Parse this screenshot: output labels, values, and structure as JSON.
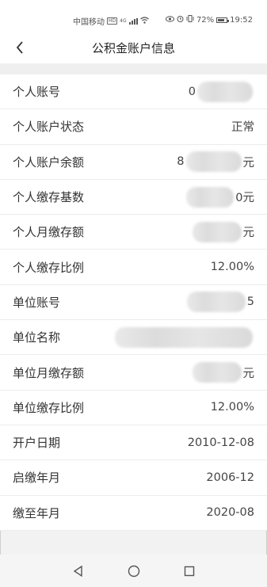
{
  "status_bar": {
    "carrier": "中国移动",
    "hd": "HD",
    "net": "4G",
    "battery": "72%",
    "time": "19:52"
  },
  "nav": {
    "title": "公积金账户信息"
  },
  "rows": [
    {
      "label": "个人账号",
      "value": "0",
      "suffix": "",
      "blur_after": true
    },
    {
      "label": "个人账户状态",
      "value": "正常",
      "suffix": "",
      "blur_after": false
    },
    {
      "label": "个人账户余额",
      "value": "8",
      "suffix": "元",
      "blur_after": true
    },
    {
      "label": "个人缴存基数",
      "value": "",
      "suffix": "0元",
      "blur_after": true
    },
    {
      "label": "个人月缴存额",
      "value": "",
      "suffix": "元",
      "blur_after": true
    },
    {
      "label": "个人缴存比例",
      "value": "12.00%",
      "suffix": "",
      "blur_after": false
    },
    {
      "label": "单位账号",
      "value": "",
      "suffix": "5",
      "blur_after": true
    },
    {
      "label": "单位名称",
      "value": "",
      "suffix": "",
      "blur_after": true
    },
    {
      "label": "单位月缴存额",
      "value": "",
      "suffix": "元",
      "blur_after": true
    },
    {
      "label": "单位缴存比例",
      "value": "12.00%",
      "suffix": "",
      "blur_after": false
    },
    {
      "label": "开户日期",
      "value": "2010-12-08",
      "suffix": "",
      "blur_after": false
    },
    {
      "label": "启缴年月",
      "value": "2006-12",
      "suffix": "",
      "blur_after": false
    },
    {
      "label": "缴至年月",
      "value": "2020-08",
      "suffix": "",
      "blur_after": false
    }
  ]
}
